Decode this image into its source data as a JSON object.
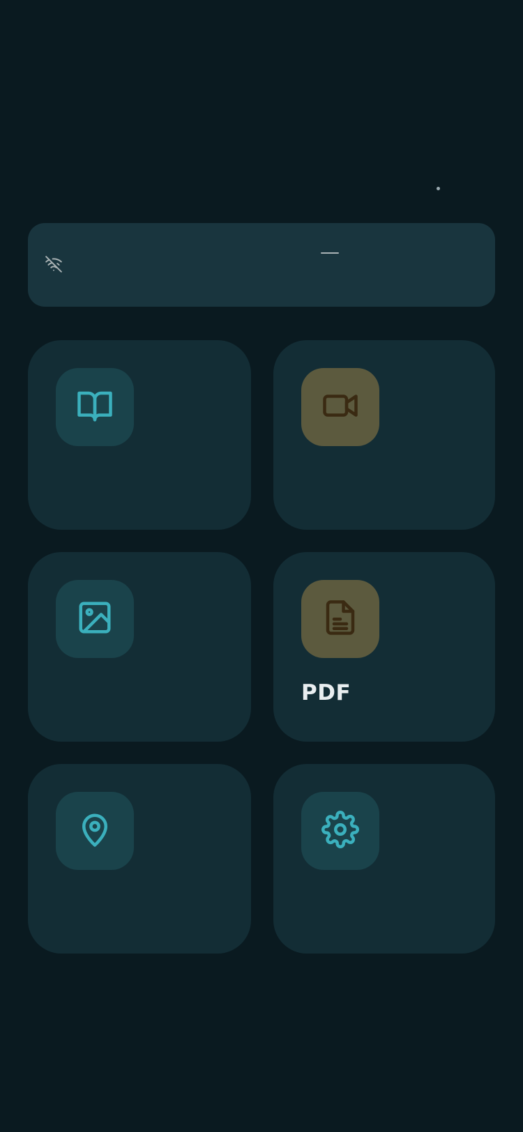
{
  "colors": {
    "background": "#0a1a20",
    "status_card": "#19353e",
    "tile": "#132d35",
    "icon_box_teal": "#1a434b",
    "icon_box_amber": "#5c5a3e",
    "icon_teal": "#3bb0bd",
    "icon_amber": "#3a2a12"
  },
  "status_card": {
    "wifi_icon": "wifi-off-icon",
    "value": "—"
  },
  "tiles": [
    {
      "icon": "book-open-icon",
      "label": ""
    },
    {
      "icon": "video-camera-icon",
      "label": ""
    },
    {
      "icon": "image-icon",
      "label": ""
    },
    {
      "icon": "file-text-icon",
      "label": "PDF"
    },
    {
      "icon": "map-pin-icon",
      "label": ""
    },
    {
      "icon": "gear-icon",
      "label": ""
    }
  ]
}
